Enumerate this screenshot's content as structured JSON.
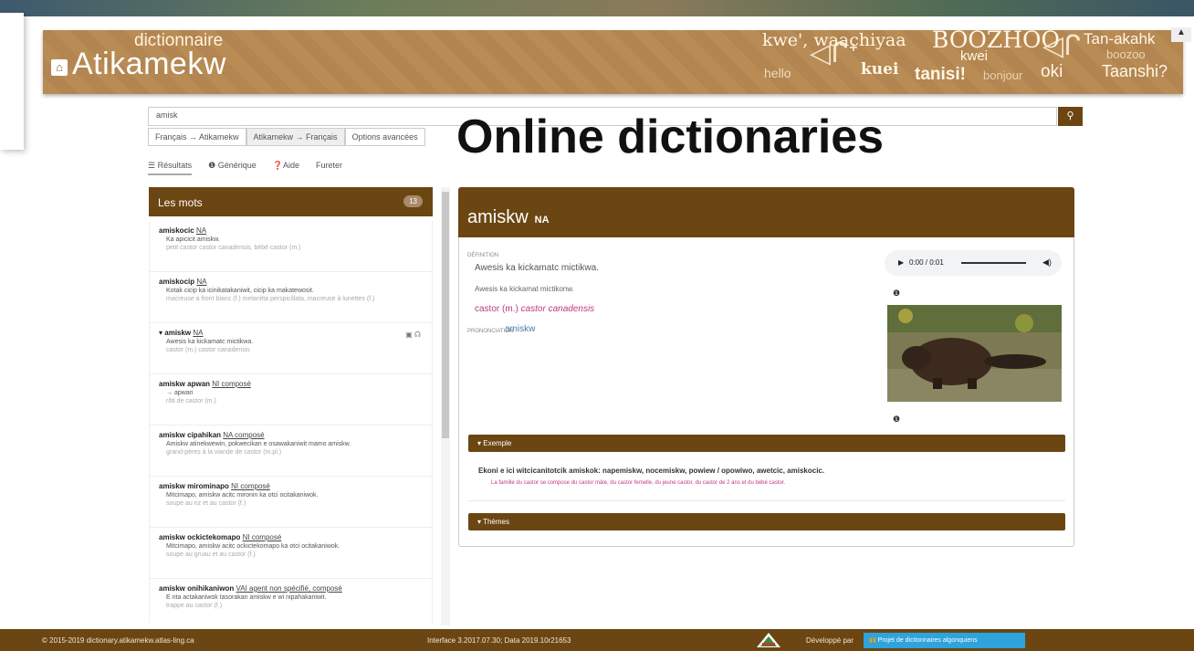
{
  "overlay_title": "Online dictionaries",
  "header": {
    "brand_small": "dictionnaire",
    "brand_big": "Atikamekw",
    "greetings": [
      "kwe', waachiyaa",
      "BOOZHOO",
      "Tan-akahk",
      "hello",
      "kuei",
      "kwei",
      "tanisi!",
      "bonjour",
      "oki",
      "boozoo",
      "Taanshi?"
    ]
  },
  "search": {
    "value": "amisk"
  },
  "tabs": [
    "Français → Atikamekw",
    "Atikamekw → Français",
    "Options avancées"
  ],
  "subtabs": [
    "Résultats",
    "Générique",
    "Aide",
    "Fureter"
  ],
  "list": {
    "title": "Les mots",
    "count": "13",
    "items": [
      {
        "word": "amiskocic",
        "cat": "NA",
        "l1": "Ka apicicit amiskw.",
        "l2": "petit castor castor canadensis, bébé castor (m.)"
      },
      {
        "word": "amiskocip",
        "cat": "NA",
        "l1": "Kotak cicip ka icinikatakaniwit, cicip ka makatewosit.",
        "l2": "macreuse à front blanc (f.) melanitta perspicillata, macreuse à lunettes (f.)"
      },
      {
        "word": "amiskw",
        "cat": "NA",
        "l1": "Awesis ka kickamatc mictikwa.",
        "l2": "castor (m.) castor canadensis"
      },
      {
        "word": "amiskw apwan",
        "cat": "NI composé",
        "l1": "→ apwan",
        "l2": "rôti de castor (m.)"
      },
      {
        "word": "amiskw cipahikan",
        "cat": "NA composé",
        "l1": "Amiskw atinekwewin, pokwecikan e osawakaniwit mamo amiskw.",
        "l2": "grand-pères à la viande de castor (m.pl.)"
      },
      {
        "word": "amiskw mirominapo",
        "cat": "NI composé",
        "l1": "Mitcimapo, amiskw acitc mironin ka otci ocitakaniwok.",
        "l2": "soupe au riz et au castor (f.)"
      },
      {
        "word": "amiskw ockictekomapo",
        "cat": "NI composé",
        "l1": "Mitcimapo, amiskw acitc ockictekomapo ka otci ocitakaniwok.",
        "l2": "soupe au gruau et au castor (f.)"
      },
      {
        "word": "amiskw onihikaniwon",
        "cat": "VAI agent non spécifié, composé",
        "l1": "E nta actakaniwok tasorakan amiskw e wi nipahakaniwit.",
        "l2": "trappe au castor (f.)"
      }
    ]
  },
  "entry": {
    "word": "amiskw",
    "cat": "NA",
    "definition_label": "DÉFINITION",
    "definition": "Awesis ka kickamatc mictikwa.",
    "definition2": "Awesis ka kickamat mictikonw.",
    "translation": "castor (m.)",
    "translation_latin": "castor canadensis",
    "pronunciation_label": "PRONONCIATION",
    "pronunciation": "amiskw",
    "audio_time": "0:00 / 0:01",
    "example_label": "▾ Exemple",
    "example": "Ekoni e ici witcicanitotcik amiskok: napemiskw, nocemiskw, powiew / opowiwo, awetcic, amiskocic.",
    "example_translation": "La famille du castor se compose du castor mâle, du castor femelle, du jeune castor, du castor de 2 ans et du bébé castor.",
    "themes_label": "▾ Thèmes"
  },
  "footer": {
    "copyright": "© 2015-2019 dictionary.atikamekw.atlas-ling.ca",
    "version": "Interface 3.2017.07.30; Data 2019.10r21653",
    "developed_by": "Développé par",
    "project_button": "Projet de dictionnaires algonquiens"
  },
  "colors": {
    "brown": "#6b4612",
    "pink": "#c0397d",
    "link": "#4a78b0",
    "footer_button": "#2ea3dc"
  }
}
